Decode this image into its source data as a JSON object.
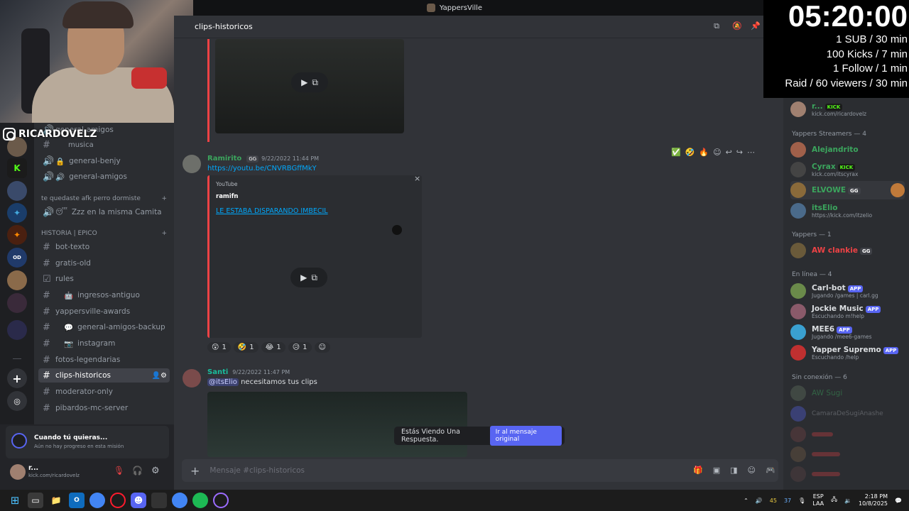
{
  "window": {
    "server_name": "YappersVille"
  },
  "overlay": {
    "instagram": "RICARDOVELZ",
    "timer": "05:20:00",
    "rules": [
      "1 SUB / 30 min",
      "100 Kicks / 7 min",
      "1 Follow / 1 min",
      "Raid / 60 viewers / 30 min"
    ]
  },
  "sidebar": {
    "channels_top": [
      {
        "label": "general-amigos"
      },
      {
        "label": "musica"
      },
      {
        "label": "general-benjy"
      },
      {
        "label": "general-amigos"
      }
    ],
    "cat1": "te quedaste afk perro dormiste",
    "afk_channel": "Zzz en la misma Camita",
    "cat2": "HISTORIA | EPICO",
    "channels": [
      {
        "label": "bot-texto"
      },
      {
        "label": "gratis-old"
      },
      {
        "label": "rules"
      },
      {
        "label": "ingresos-antiguo"
      },
      {
        "label": "yappersville-awards"
      },
      {
        "label": "general-amigos-backup"
      },
      {
        "label": "instagram"
      },
      {
        "label": "fotos-legendarias"
      },
      {
        "label": "clips-historicos"
      },
      {
        "label": "moderator-only"
      },
      {
        "label": "pibardos-mc-server"
      }
    ]
  },
  "mission": {
    "title": "Cuando tú quieras...",
    "sub": "Aún no hay progreso en esta misión"
  },
  "user": {
    "name": "r...",
    "status": "kick.com/ricardovelz"
  },
  "channel": {
    "name": "clips-historicos",
    "placeholder": "Mensaje #clips-historicos"
  },
  "messages": [
    {
      "author": "Ramirito",
      "tag": "GG",
      "time": "9/22/2022 11:44 PM",
      "link": "https://youtu.be/CNVRBGffMkY",
      "embed_provider": "YouTube",
      "embed_author": "ramifn",
      "embed_title": "LE ESTABA DISPARANDO IMBECIL",
      "reactions": [
        "1",
        "1",
        "1",
        "1"
      ]
    },
    {
      "author": "Santi",
      "time": "9/22/2022 11:47 PM",
      "mention": "@itsElio",
      "text": "necesitamos tus clips"
    }
  ],
  "jump_bar": {
    "text": "Estás Viendo Una Respuesta.",
    "button": "Ir al mensaje original"
  },
  "members": {
    "top": {
      "name": "r...",
      "badge": "KICK",
      "status": "kick.com/ricardovelz"
    },
    "streamers_header": "Yappers Streamers — 4",
    "streamers": [
      {
        "name": "Alejandrito",
        "badge": "",
        "status": "",
        "color": "#3ba55d"
      },
      {
        "name": "Cyrax",
        "badge": "KICK",
        "status": "kick.com/itscyrax",
        "color": "#3ba55d"
      },
      {
        "name": "ELVOWE",
        "badge": "GG",
        "status": "",
        "color": "#3ba55d"
      },
      {
        "name": "itsElio",
        "badge": "",
        "status": "https://kick.com/itzelio",
        "color": "#3ba55d"
      }
    ],
    "yappers_header": "Yappers — 1",
    "yappers": [
      {
        "name": "AW clankie",
        "badge": "GG",
        "color": "#ed4245"
      }
    ],
    "online_header": "En línea — 4",
    "online": [
      {
        "name": "Carl-bot",
        "badge": "APP",
        "status": "Jugando /games | carl.gg"
      },
      {
        "name": "Jockie Music",
        "badge": "APP",
        "status": "Escuchando m!help"
      },
      {
        "name": "MEE6",
        "badge": "APP",
        "status": "Jugando /mee6-games"
      },
      {
        "name": "Yapper Supremo",
        "badge": "APP",
        "status": "Escuchando /help"
      }
    ],
    "offline_header": "Sin conexión — 6",
    "offline": [
      {
        "name": "AW Sugi"
      },
      {
        "name": "CamaraDeSugiAnashe"
      }
    ]
  },
  "taskbar": {
    "lang": "ESP",
    "lang2": "LAA",
    "time": "2:18 PM",
    "date": "10/8/2025",
    "temp1": "45",
    "temp2": "37"
  }
}
